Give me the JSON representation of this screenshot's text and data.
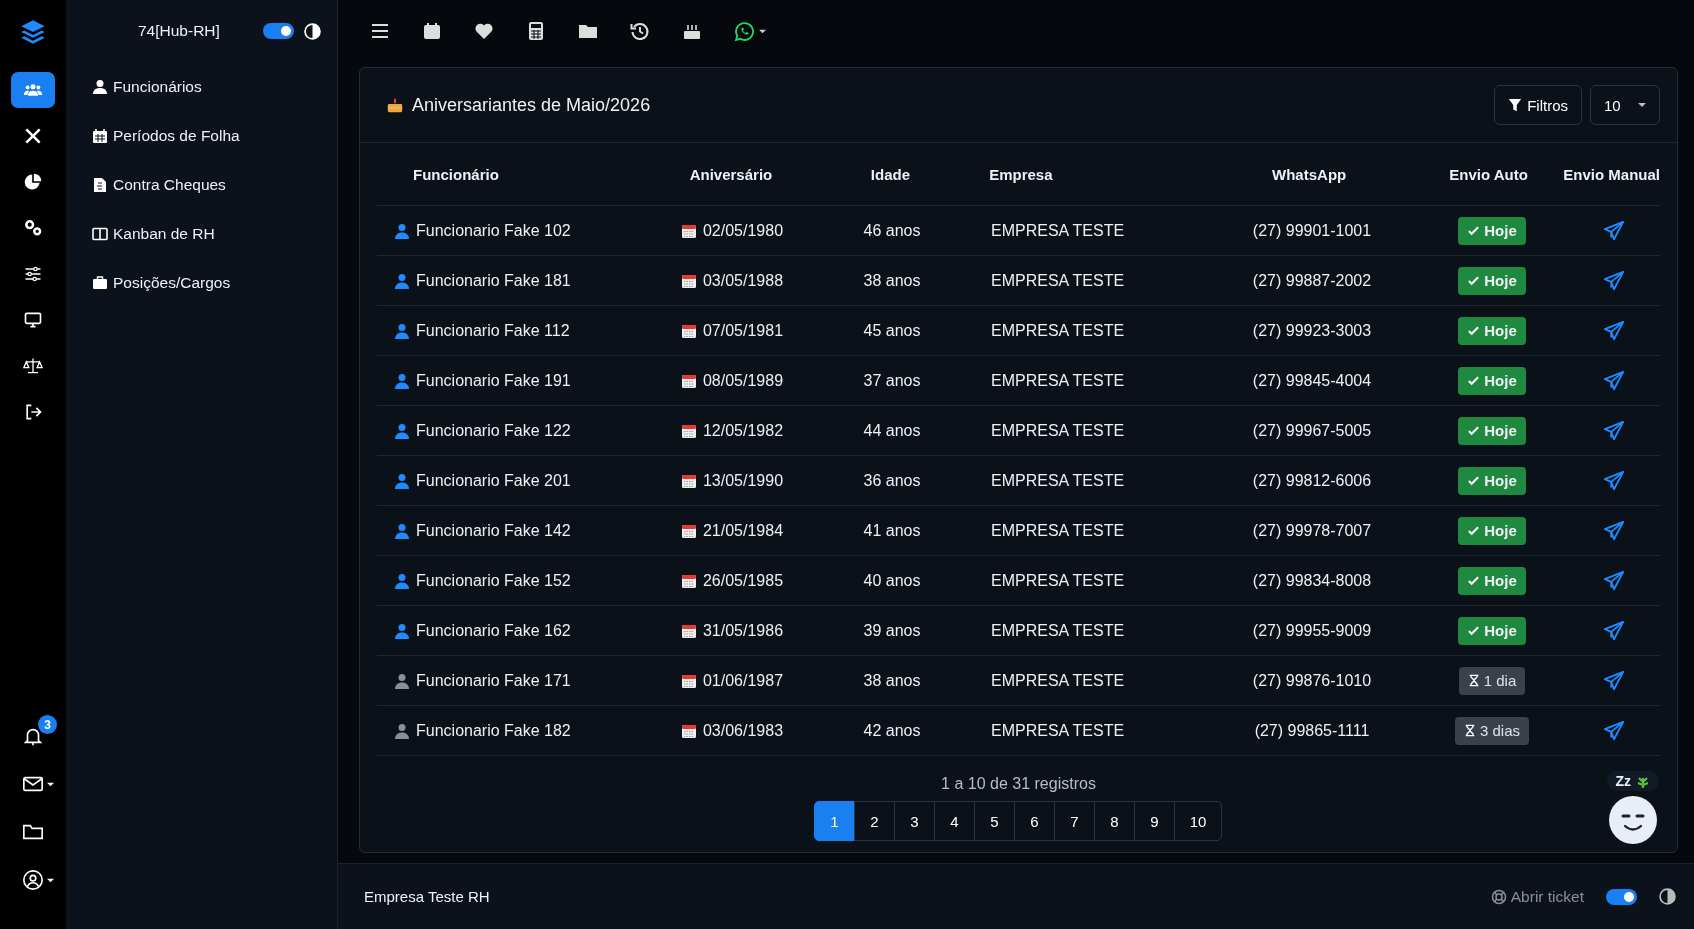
{
  "rail": {
    "top": [
      {
        "selected": true
      },
      {
        "selected": false
      },
      {
        "selected": false
      },
      {
        "selected": false
      },
      {
        "selected": false
      },
      {
        "selected": false
      },
      {
        "selected": false
      },
      {
        "selected": false
      }
    ],
    "notifications": {
      "badge": "3"
    }
  },
  "sidebar": {
    "title": "74[Hub-RH]",
    "toggle_on": true,
    "items": [
      {
        "label": "Funcionários"
      },
      {
        "label": "Períodos de Folha"
      },
      {
        "label": "Contra Cheques"
      },
      {
        "label": "Kanban de RH"
      },
      {
        "label": "Posições/Cargos"
      }
    ]
  },
  "card": {
    "title": "Aniversariantes de Maio/2026",
    "filter_button": "Filtros",
    "page_size": "10",
    "columns": [
      "Funcionário",
      "Aniversário",
      "Idade",
      "Empresa",
      "WhatsApp",
      "Envio Auto",
      "Envio Manual"
    ],
    "rows": [
      {
        "name": "Funcionario Fake 102",
        "birthday": "02/05/1980",
        "age": "46 anos",
        "company": "EMPRESA TESTE",
        "whatsapp": "(27) 99901-1001",
        "auto": {
          "kind": "today",
          "label": "Hoje"
        }
      },
      {
        "name": "Funcionario Fake 181",
        "birthday": "03/05/1988",
        "age": "38 anos",
        "company": "EMPRESA TESTE",
        "whatsapp": "(27) 99887-2002",
        "auto": {
          "kind": "today",
          "label": "Hoje"
        }
      },
      {
        "name": "Funcionario Fake 112",
        "birthday": "07/05/1981",
        "age": "45 anos",
        "company": "EMPRESA TESTE",
        "whatsapp": "(27) 99923-3003",
        "auto": {
          "kind": "today",
          "label": "Hoje"
        }
      },
      {
        "name": "Funcionario Fake 191",
        "birthday": "08/05/1989",
        "age": "37 anos",
        "company": "EMPRESA TESTE",
        "whatsapp": "(27) 99845-4004",
        "auto": {
          "kind": "today",
          "label": "Hoje"
        }
      },
      {
        "name": "Funcionario Fake 122",
        "birthday": "12/05/1982",
        "age": "44 anos",
        "company": "EMPRESA TESTE",
        "whatsapp": "(27) 99967-5005",
        "auto": {
          "kind": "today",
          "label": "Hoje"
        }
      },
      {
        "name": "Funcionario Fake 201",
        "birthday": "13/05/1990",
        "age": "36 anos",
        "company": "EMPRESA TESTE",
        "whatsapp": "(27) 99812-6006",
        "auto": {
          "kind": "today",
          "label": "Hoje"
        }
      },
      {
        "name": "Funcionario Fake 142",
        "birthday": "21/05/1984",
        "age": "41 anos",
        "company": "EMPRESA TESTE",
        "whatsapp": "(27) 99978-7007",
        "auto": {
          "kind": "today",
          "label": "Hoje"
        }
      },
      {
        "name": "Funcionario Fake 152",
        "birthday": "26/05/1985",
        "age": "40 anos",
        "company": "EMPRESA TESTE",
        "whatsapp": "(27) 99834-8008",
        "auto": {
          "kind": "today",
          "label": "Hoje"
        }
      },
      {
        "name": "Funcionario Fake 162",
        "birthday": "31/05/1986",
        "age": "39 anos",
        "company": "EMPRESA TESTE",
        "whatsapp": "(27) 99955-9009",
        "auto": {
          "kind": "today",
          "label": "Hoje"
        }
      },
      {
        "name": "Funcionario Fake 171",
        "birthday": "01/06/1987",
        "age": "38 anos",
        "company": "EMPRESA TESTE",
        "whatsapp": "(27) 99876-1010",
        "auto": {
          "kind": "pending",
          "label": "1 dia"
        }
      },
      {
        "name": "Funcionario Fake 182",
        "birthday": "03/06/1983",
        "age": "42 anos",
        "company": "EMPRESA TESTE",
        "whatsapp": "(27) 99865-1111",
        "auto": {
          "kind": "pending",
          "label": "3 dias"
        }
      }
    ],
    "summary": "1 a 10 de 31 registros",
    "pages": [
      {
        "label": "1",
        "selected": true
      },
      {
        "label": "2",
        "selected": false
      },
      {
        "label": "3",
        "selected": false
      },
      {
        "label": "4",
        "selected": false
      },
      {
        "label": "5",
        "selected": false
      },
      {
        "label": "6",
        "selected": false
      },
      {
        "label": "7",
        "selected": false
      },
      {
        "label": "8",
        "selected": false
      },
      {
        "label": "9",
        "selected": false
      },
      {
        "label": "10",
        "selected": false
      }
    ]
  },
  "assistant": {
    "status": "Zz"
  },
  "footer": {
    "company": "Empresa Teste RH",
    "ticket_link": "Abrir ticket",
    "toggle_on": true
  }
}
